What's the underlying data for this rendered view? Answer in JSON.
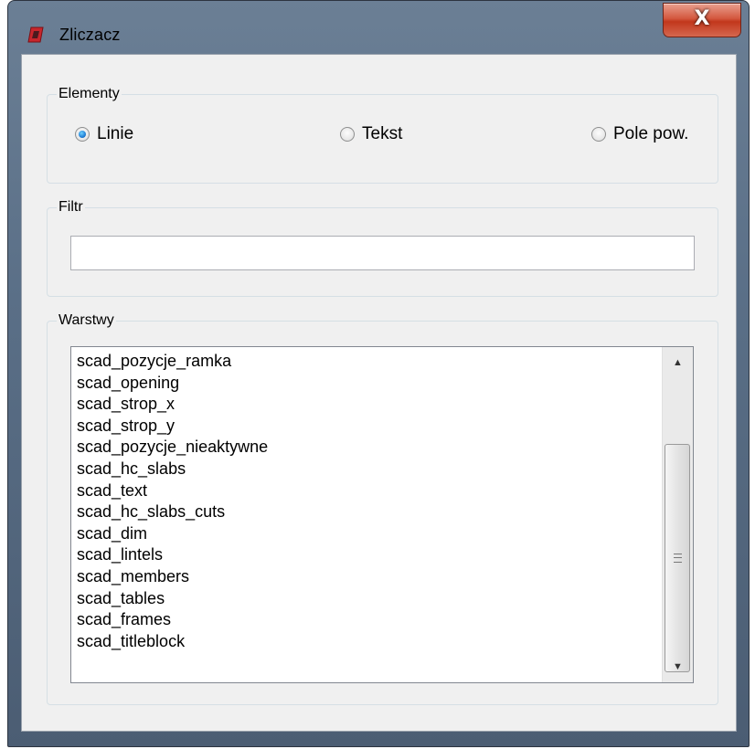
{
  "window": {
    "title": "Zliczacz",
    "close_glyph": "X"
  },
  "icons": {
    "app": "autocad-logo-icon",
    "close": "close-icon"
  },
  "elementy": {
    "legend": "Elementy",
    "options": [
      {
        "label": "Linie",
        "selected": true
      },
      {
        "label": "Tekst",
        "selected": false
      },
      {
        "label": "Pole pow.",
        "selected": false
      }
    ]
  },
  "filtr": {
    "legend": "Filtr",
    "value": "",
    "placeholder": ""
  },
  "warstwy": {
    "legend": "Warstwy",
    "items": [
      "scad_pozycje_ramka",
      "scad_opening",
      "scad_strop_x",
      "scad_strop_y",
      "scad_pozycje_nieaktywne",
      "scad_hc_slabs",
      "scad_text",
      "scad_hc_slabs_cuts",
      "scad_dim",
      "scad_lintels",
      "scad_members",
      "scad_tables",
      "scad_frames",
      "scad_titleblock"
    ]
  },
  "colors": {
    "accent": "#1f7fd6",
    "close_button": "#c2371c",
    "app_icon": "#c8262c"
  }
}
